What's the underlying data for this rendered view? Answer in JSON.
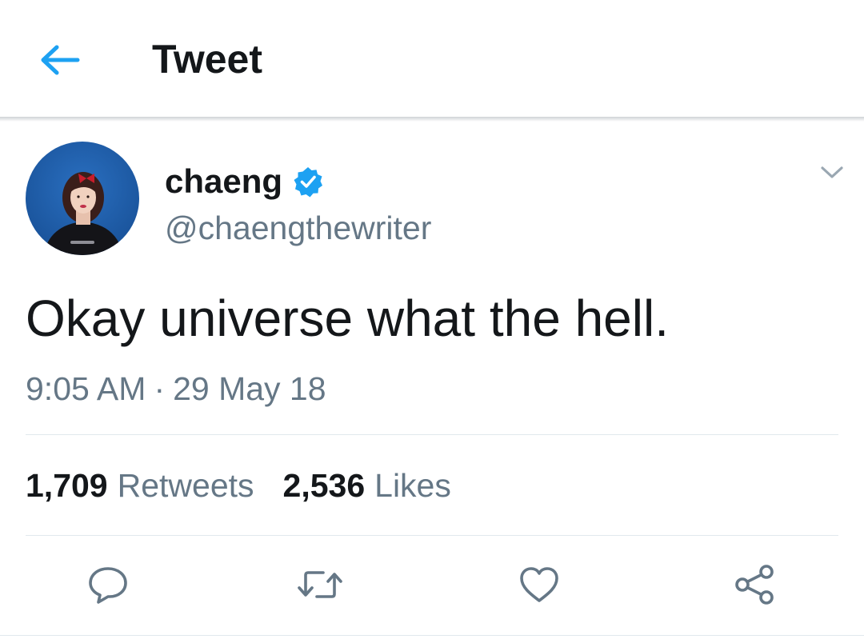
{
  "header": {
    "title": "Tweet",
    "back_icon": "arrow-left-icon",
    "accent_color": "#1da1f2"
  },
  "tweet": {
    "author": {
      "name": "chaeng",
      "handle": "@chaengthewriter",
      "verified": true,
      "avatar_icon": "avatar-photo",
      "avatar_background": "#1f5fae"
    },
    "text": "Okay universe what the hell.",
    "time": "9:05 AM",
    "separator": "·",
    "date": "29 May 18",
    "menu_icon": "chevron-down-icon"
  },
  "stats": {
    "retweets_count": "1,709",
    "retweets_label": "Retweets",
    "likes_count": "2,536",
    "likes_label": "Likes"
  },
  "actions": [
    {
      "name": "reply",
      "icon": "reply-icon"
    },
    {
      "name": "retweet",
      "icon": "retweet-icon"
    },
    {
      "name": "like",
      "icon": "heart-icon"
    },
    {
      "name": "share",
      "icon": "share-icon"
    }
  ],
  "colors": {
    "text_primary": "#14171a",
    "text_secondary": "#657786",
    "divider": "#e1e8ed",
    "icon_gray": "#657786",
    "verified_blue": "#1da1f2"
  }
}
